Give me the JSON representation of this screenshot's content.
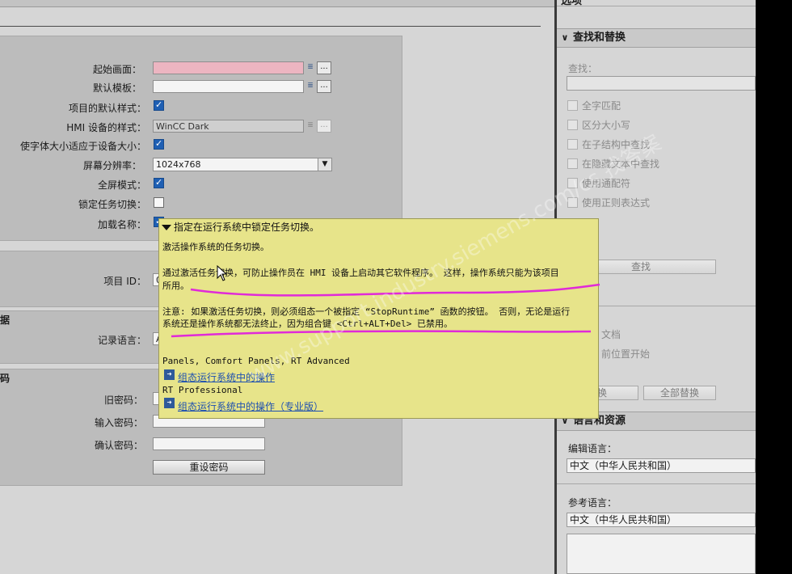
{
  "form": {
    "start_screen_label": "起始画面：",
    "default_template_label": "默认模板：",
    "project_default_style_label": "项目的默认样式：",
    "hmi_style_label": "HMI 设备的样式：",
    "hmi_style_value": "WinCC Dark",
    "font_adapt_label": "使字体大小适应于设备大小：",
    "resolution_label": "屏幕分辨率：",
    "resolution_value": "1024x768",
    "fullscreen_label": "全屏模式：",
    "lock_task_label": "锁定任务切换：",
    "load_names_label": "加载名称：",
    "ellipsis": "...",
    "list_icon": "≣",
    "dropdown_arrow": "▼",
    "project_id_label": "项目 ID：",
    "project_id_value": "0",
    "section_data_title": "据",
    "log_language_label": "记录语言：",
    "log_language_value": "A",
    "section_password_title": "码",
    "old_password_label": "旧密码：",
    "new_password_label": "输入密码：",
    "confirm_password_label": "确认密码：",
    "reset_password_button": "重设密码"
  },
  "tooltip": {
    "title": "指定在运行系统中锁定任务切换。",
    "line1": "激活操作系统的任务切换。",
    "line2": "通过激活任务切换，可防止操作员在 HMI 设备上启动其它软件程序。 这样，操作系统只能为该项目",
    "line3": "所用。",
    "line4": "注意: 如果激活任务切换，则必须组态一个被指定 “StopRuntime” 函数的按钮。 否则，无论是运行",
    "line5": "系统还是操作系统都无法终止，因为组合键 <Ctrl+ALT+Del> 已禁用。",
    "platform1": "Panels, Comfort Panels, RT Advanced",
    "link1": "组态运行系统中的操作",
    "platform2": "RT Professional",
    "link2": "组态运行系统中的操作（专业版）",
    "annotation_color": "#e02ad8"
  },
  "right": {
    "top_title": "选项",
    "find_replace_title": "查找和替换",
    "find_label": "查找：",
    "opt_whole_word": "全字匹配",
    "opt_match_case": "区分大小写",
    "opt_find_in_struct": "在子结构中查找",
    "opt_find_hidden": "在隐藏文本中查找",
    "opt_wildcard": "使用通配符",
    "opt_regex": "使用正则表达式",
    "find_button": "查找",
    "whole_doc": "文档",
    "from_current": "前位置开始",
    "replace_button": "换",
    "replace_all_button": "全部替换",
    "lang_res_title": "语言和资源",
    "edit_lang_label": "编辑语言：",
    "edit_lang_value": "中文（中华人民共和国）",
    "ref_lang_label": "参考语言：",
    "ref_lang_value": "中文（中华人民共和国）",
    "chevron": "∨"
  },
  "watermark": "www.support.industry.siemens.com/cs  找答案"
}
